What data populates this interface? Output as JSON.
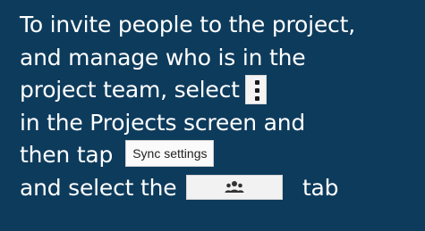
{
  "tip": {
    "line1": "To invite people to the project,",
    "line2": "and manage who is in the",
    "line3": "project team, select",
    "line4": "in the Projects screen and",
    "line5": "then tap",
    "line6_before": "and select the",
    "line6_after": "tab"
  },
  "buttons": {
    "menu_icon": "vertical-ellipsis-icon",
    "sync_settings_label": "Sync settings",
    "team_tab_icon": "people-group-icon"
  },
  "colors": {
    "background": "#0d3b5c",
    "text": "#ffffff"
  }
}
